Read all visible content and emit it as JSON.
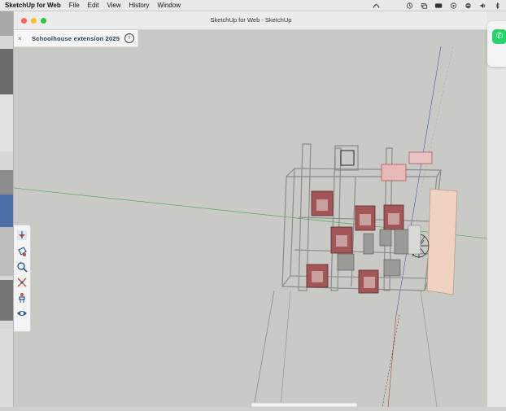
{
  "menubar": {
    "app_name": "SketchUp for Web",
    "items": [
      "File",
      "Edit",
      "View",
      "History",
      "Window"
    ],
    "status_icons": [
      "siri-icon",
      "time-machine-icon",
      "screen-mirror-icon",
      "battery-icon",
      "play-icon",
      "wifi-icon",
      "volume-icon",
      "bluetooth-icon"
    ]
  },
  "window": {
    "title": "SketchUp for Web - SketchUp"
  },
  "model": {
    "close_symbol": "×",
    "name": "Schoolhouse extension 2025",
    "info_symbol": "i"
  },
  "toolbar": {
    "tools": [
      "select-icon",
      "paint-bucket-icon",
      "search-icon",
      "move-icon",
      "person-walk-icon",
      "eye-icon"
    ]
  },
  "background_apps": {
    "whatsapp_symbol": "✆"
  },
  "colors": {
    "viewport_bg": "#c9cac5",
    "model_title": "#1e3a5c",
    "room_red": "#9c3a3a",
    "axis_green": "#3fa34d",
    "axis_red": "#c23a3a",
    "axis_blue": "#4a55c8"
  }
}
